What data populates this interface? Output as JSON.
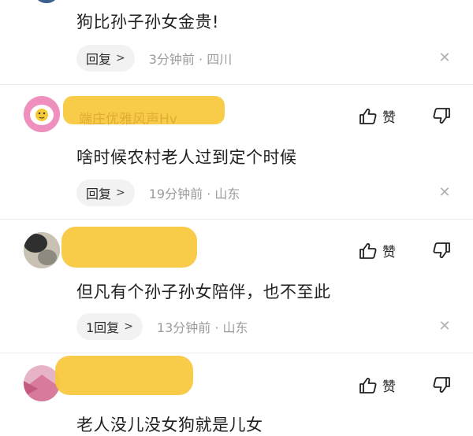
{
  "comments": [
    {
      "text": "狗比孙子孙女金贵!",
      "reply_label": "回复",
      "time_location": "3分钟前 · 四川"
    },
    {
      "username": "端庄优雅风声Hv",
      "like_label": "赞",
      "text": "啥时候农村老人过到定个时候",
      "reply_label": "回复",
      "time_location": "19分钟前 · 山东"
    },
    {
      "like_label": "赞",
      "text": "但凡有个孙子孙女陪伴，也不至此",
      "reply_label": "1回复",
      "time_location": "13分钟前 · 山东"
    },
    {
      "like_label": "赞",
      "text": "老人没儿没女狗就是儿女"
    }
  ],
  "icons": {
    "like": "thumbs-up-icon",
    "dislike": "thumbs-down-icon",
    "close": "close-icon",
    "chevron": "chevron-right-icon"
  },
  "colors": {
    "redaction": "#f7c83a",
    "meta_gray": "#9b9b9b",
    "pill_bg": "#f2f2f2"
  }
}
